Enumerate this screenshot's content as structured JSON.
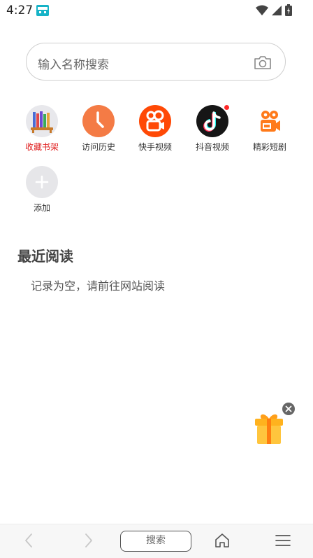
{
  "status_bar": {
    "time": "4:27"
  },
  "search": {
    "placeholder": "输入名称搜索"
  },
  "shortcuts": [
    {
      "label": "收藏书架",
      "icon": "bookshelf-icon",
      "label_color": "#e02020"
    },
    {
      "label": "访问历史",
      "icon": "clock-icon",
      "label_color": "#333333"
    },
    {
      "label": "快手视频",
      "icon": "kuaishou-icon",
      "label_color": "#333333"
    },
    {
      "label": "抖音视频",
      "icon": "douyin-icon",
      "label_color": "#333333"
    },
    {
      "label": "精彩短剧",
      "icon": "short-drama-icon",
      "label_color": "#333333"
    },
    {
      "label": "添加",
      "icon": "plus-icon",
      "label_color": "#333333"
    }
  ],
  "recent": {
    "title": "最近阅读",
    "empty_text": "记录为空，请前往网站阅读"
  },
  "bottom_nav": {
    "search_label": "搜索"
  },
  "colors": {
    "accent_red": "#e02020",
    "clock_orange": "#f47b45",
    "kuaishou_orange": "#ff4906",
    "douyin_black": "#161616",
    "drama_orange": "#ff7a1a"
  }
}
